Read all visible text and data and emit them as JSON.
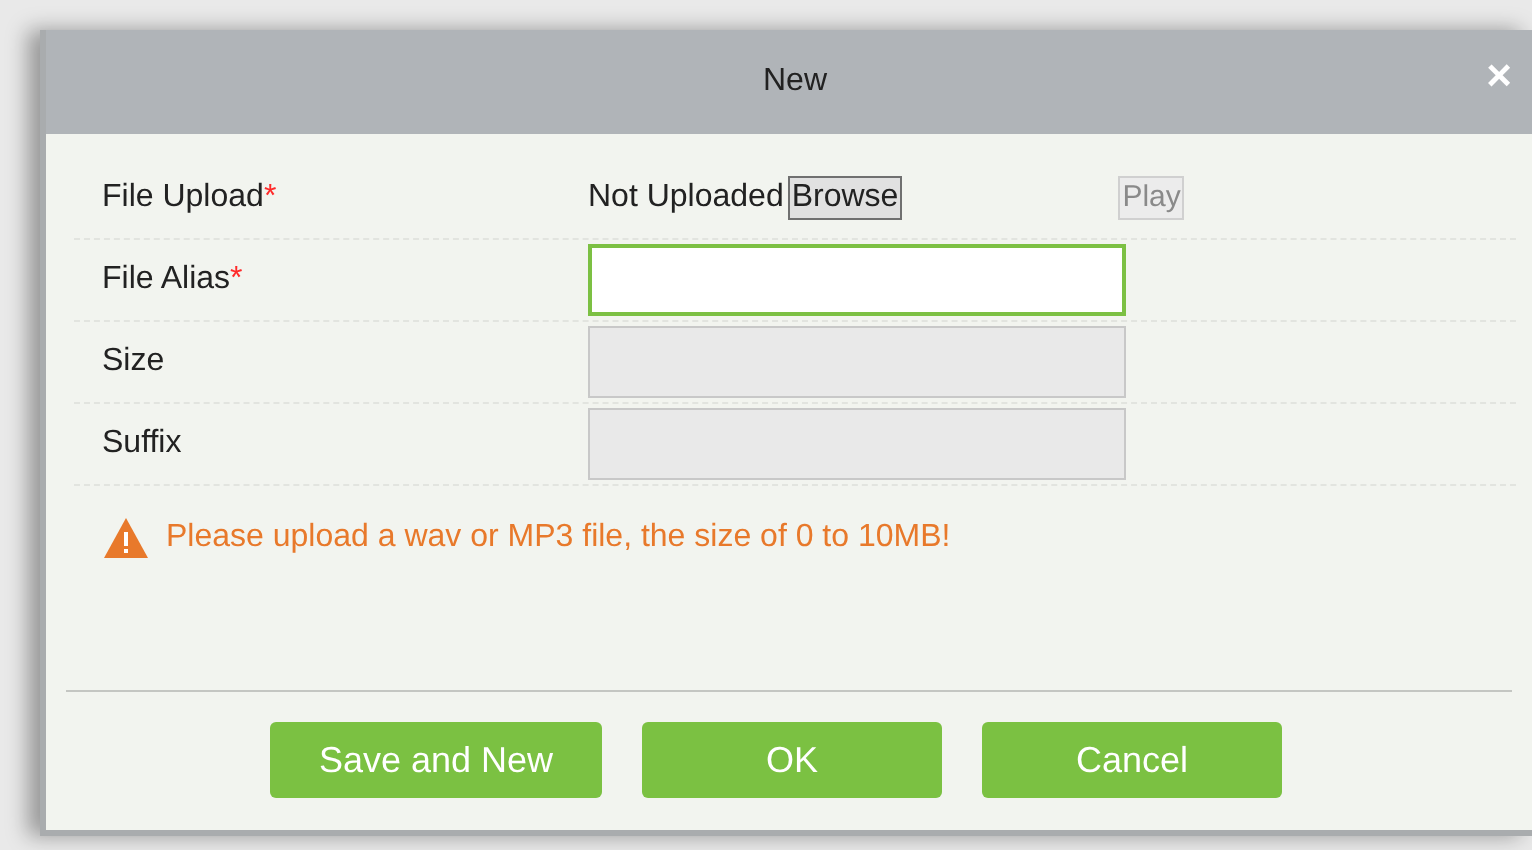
{
  "dialog": {
    "title": "New",
    "close": "×"
  },
  "rows": [
    {
      "kind": "upload",
      "label": "File Upload",
      "required_mark": "*",
      "status": "Not Uploaded",
      "browse": "Browse",
      "play": "Play"
    },
    {
      "kind": "input",
      "label": "File Alias",
      "required_mark": "*",
      "focused": true
    },
    {
      "kind": "input",
      "label": "Size",
      "focused": false,
      "disabled": true
    },
    {
      "kind": "input",
      "label": "Suffix",
      "focused": false,
      "disabled": true
    }
  ],
  "warning": "Please upload a wav or MP3 file, the size of 0 to 10MB!",
  "buttons": [
    "Save and New",
    "OK",
    "Cancel"
  ]
}
